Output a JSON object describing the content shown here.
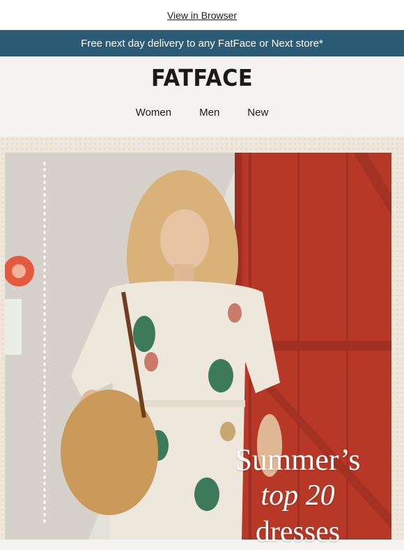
{
  "header": {
    "view_in_browser": "View in Browser",
    "promo": "Free next day delivery to any FatFace or Next store*",
    "logo": "FATFACE"
  },
  "nav": {
    "items": [
      "Women",
      "Men",
      "New"
    ]
  },
  "hero": {
    "line1": "Summer’s",
    "line2": "top 20",
    "line3": "dresses"
  },
  "colors": {
    "banner": "#2c5b76",
    "door_red": "#b73827",
    "background": "#f5f3ef"
  }
}
